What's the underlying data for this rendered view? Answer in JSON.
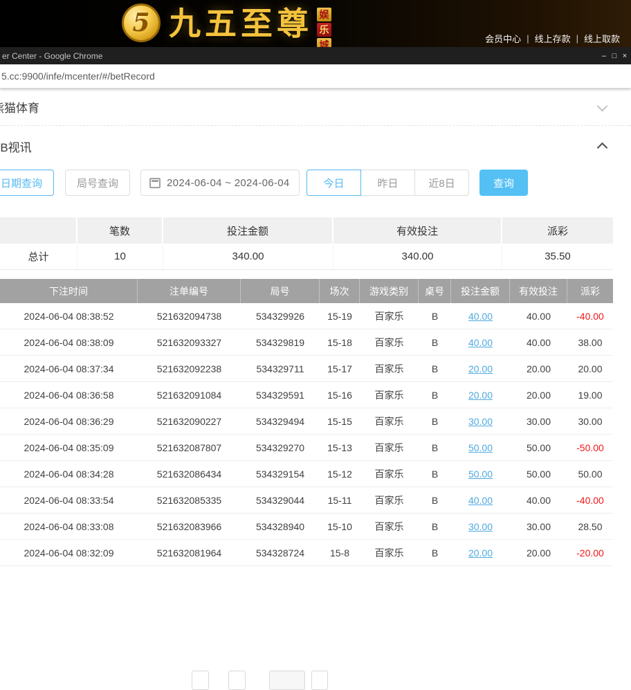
{
  "colors": {
    "accent_blue": "#53b9f1",
    "link_blue": "#4da9e0",
    "negative_red": "#f21616",
    "brand_gold": "#f5c33c"
  },
  "banner": {
    "coin_text": "5",
    "brand": "九五至尊",
    "badge": [
      "娱",
      "乐",
      "城"
    ],
    "separator": "|",
    "nav": [
      {
        "label": "会员中心"
      },
      {
        "label": "线上存款"
      },
      {
        "label": "线上取款"
      }
    ]
  },
  "browser": {
    "title": "er Center - Google Chrome",
    "minimize": "–",
    "maximize": "□",
    "close": "×",
    "url": "5.cc:9900/infe/mcenter/#/betRecord"
  },
  "sections": {
    "sports": "熊猫体育",
    "bb": "BB视讯"
  },
  "filters": {
    "date_query": "日期查询",
    "round_query": "局号查询",
    "date_range": "2024-06-04 ~ 2024-06-04",
    "today": "今日",
    "yesterday": "昨日",
    "last8": "近8日",
    "search": "查询"
  },
  "summary": {
    "col_count": "笔数",
    "col_amount": "投注金额",
    "col_valid": "有效投注",
    "col_payout": "派彩",
    "total_label": "总计",
    "count": "10",
    "amount": "340.00",
    "valid": "340.00",
    "payout": "35.50"
  },
  "table": {
    "headers": [
      "下注时间",
      "注单编号",
      "局号",
      "场次",
      "游戏类别",
      "桌号",
      "投注金额",
      "有效投注",
      "派彩"
    ],
    "rows": [
      [
        "2024-06-04 08:38:52",
        "521632094738",
        "534329926",
        "15-19",
        "百家乐",
        "B",
        "40.00",
        "40.00",
        "-40.00"
      ],
      [
        "2024-06-04 08:38:09",
        "521632093327",
        "534329819",
        "15-18",
        "百家乐",
        "B",
        "40.00",
        "40.00",
        "38.00"
      ],
      [
        "2024-06-04 08:37:34",
        "521632092238",
        "534329711",
        "15-17",
        "百家乐",
        "B",
        "20.00",
        "20.00",
        "20.00"
      ],
      [
        "2024-06-04 08:36:58",
        "521632091084",
        "534329591",
        "15-16",
        "百家乐",
        "B",
        "20.00",
        "20.00",
        "19.00"
      ],
      [
        "2024-06-04 08:36:29",
        "521632090227",
        "534329494",
        "15-15",
        "百家乐",
        "B",
        "30.00",
        "30.00",
        "30.00"
      ],
      [
        "2024-06-04 08:35:09",
        "521632087807",
        "534329270",
        "15-13",
        "百家乐",
        "B",
        "50.00",
        "50.00",
        "-50.00"
      ],
      [
        "2024-06-04 08:34:28",
        "521632086434",
        "534329154",
        "15-12",
        "百家乐",
        "B",
        "50.00",
        "50.00",
        "50.00"
      ],
      [
        "2024-06-04 08:33:54",
        "521632085335",
        "534329044",
        "15-11",
        "百家乐",
        "B",
        "40.00",
        "40.00",
        "-40.00"
      ],
      [
        "2024-06-04 08:33:08",
        "521632083966",
        "534328940",
        "15-10",
        "百家乐",
        "B",
        "30.00",
        "30.00",
        "28.50"
      ],
      [
        "2024-06-04 08:32:09",
        "521632081964",
        "534328724",
        "15-8",
        "百家乐",
        "B",
        "20.00",
        "20.00",
        "-20.00"
      ]
    ]
  }
}
